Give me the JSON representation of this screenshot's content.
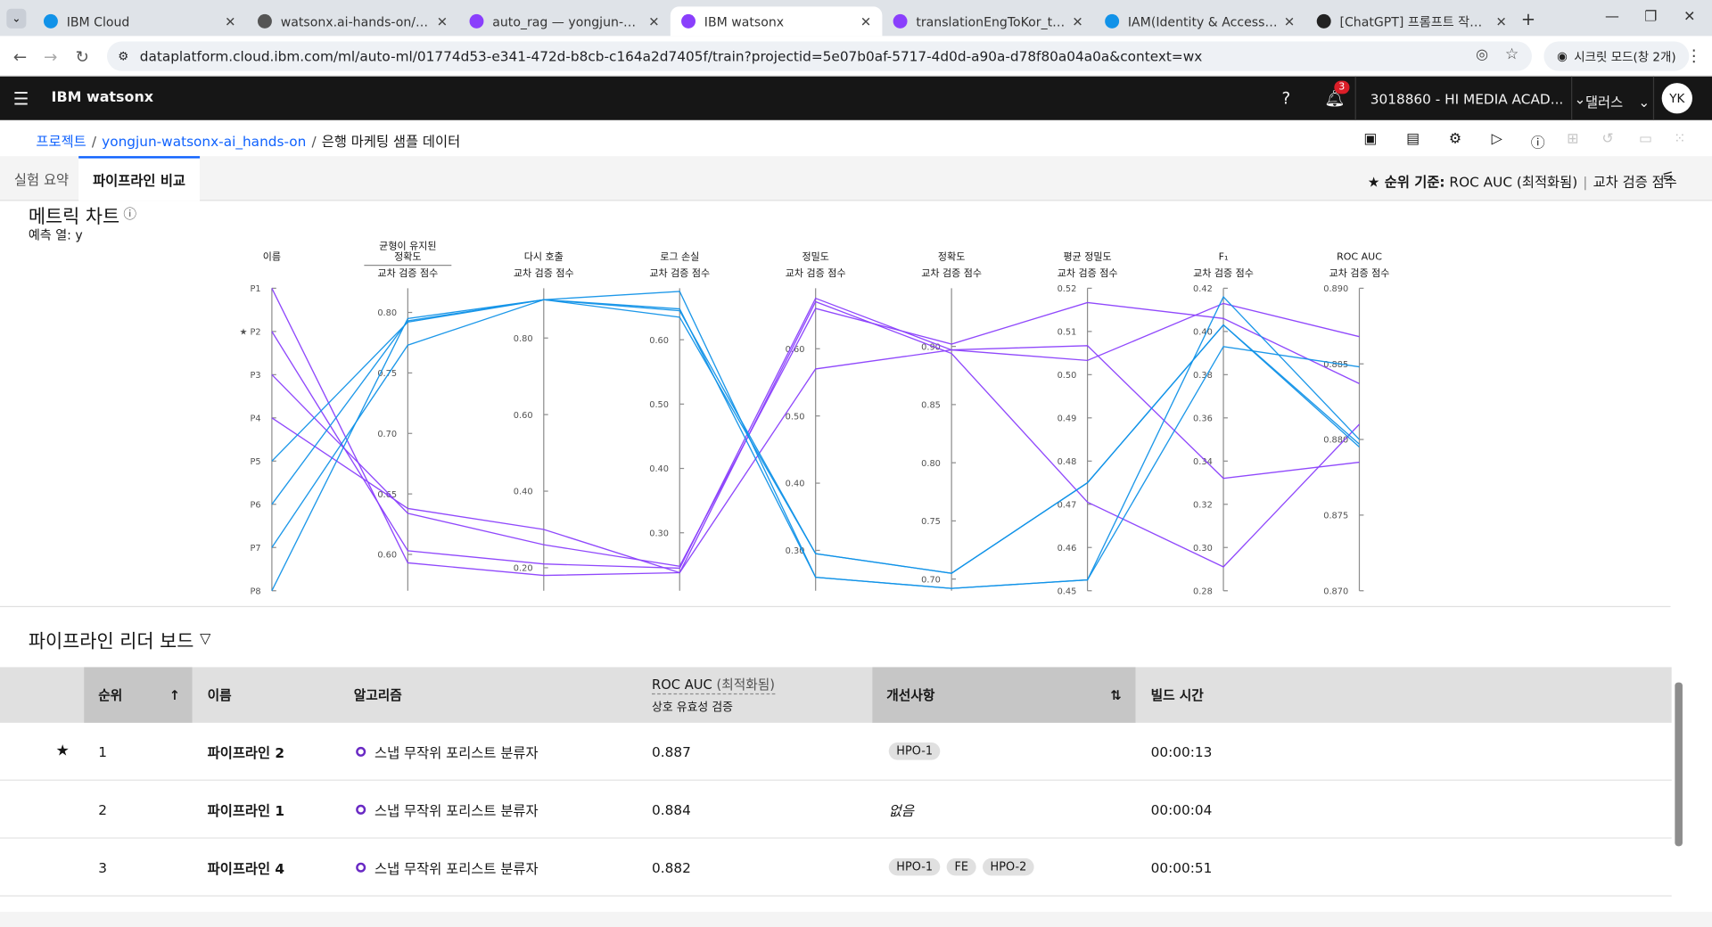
{
  "browser": {
    "tabs": [
      {
        "title": "IBM Cloud",
        "color": "#1192e8"
      },
      {
        "title": "watsonx.ai-hands-on/README",
        "color": "#555555"
      },
      {
        "title": "auto_rag — yongjun-watsonx",
        "color": "#8a3ffc"
      },
      {
        "title": "IBM watsonx",
        "color": "#8a3ffc"
      },
      {
        "title": "translationEngToKor_test — yo",
        "color": "#8a3ffc"
      },
      {
        "title": "IAM(Identity & Access Manag",
        "color": "#1192e8"
      },
      {
        "title": "[ChatGPT] 프롬프트 작성 가이",
        "color": "#222222"
      }
    ],
    "url": "dataplatform.cloud.ibm.com/ml/auto-ml/01774d53-e341-472d-b8cb-c164a2d7405f/train?projectid=5e07b0af-5717-4d0d-a90a-d78f80a04a0a&context=wx",
    "incognito_label": "시크릿 모드(창 2개)"
  },
  "app": {
    "brand": "IBM watsonx",
    "notifications": "3",
    "account": "3018860 - HI MEDIA ACAD...",
    "region": "댈러스",
    "avatar": "YK"
  },
  "breadcrumb": {
    "root": "프로젝트",
    "project": "yongjun-watsonx-ai_hands-on",
    "current": "은행 마케팅 샘플 데이터"
  },
  "subtabs": {
    "summary": "실험 요약",
    "compare": "파이프라인 비교",
    "rank_label": "★ 순위 기준:",
    "rank_metric": "ROC AUC (최적화됨)",
    "rank_score": "교차 검증 점수"
  },
  "metric": {
    "title": "메트릭 차트",
    "prediction_label": "예측 열:",
    "prediction_value": "y"
  },
  "chart_data": {
    "type": "parallel-coordinates",
    "axes": [
      {
        "label": "이름",
        "sub": "",
        "ticks": [
          "P1",
          "★ P2",
          "P3",
          "P4",
          "P5",
          "P6",
          "P7",
          "P8"
        ],
        "categorical": true
      },
      {
        "label": "균형이 유지된\n정확도",
        "sub": "교차 검증 점수",
        "min": 0.57,
        "max": 0.82,
        "ticks": [
          0.6,
          0.65,
          0.7,
          0.75,
          0.8
        ]
      },
      {
        "label": "다시 호출",
        "sub": "교차 검증 점수",
        "min": 0.14,
        "max": 0.93,
        "ticks": [
          0.2,
          0.4,
          0.6,
          0.8
        ]
      },
      {
        "label": "로그 손실",
        "sub": "교차 검증 점수",
        "min": 0.21,
        "max": 0.68,
        "ticks": [
          0.3,
          0.4,
          0.5,
          0.6
        ]
      },
      {
        "label": "정밀도",
        "sub": "교차 검증 점수",
        "min": 0.24,
        "max": 0.69,
        "ticks": [
          0.3,
          0.4,
          0.5,
          0.6
        ]
      },
      {
        "label": "정확도",
        "sub": "교차 검증 점수",
        "min": 0.69,
        "max": 0.95,
        "ticks": [
          0.7,
          0.75,
          0.8,
          0.85,
          0.9
        ]
      },
      {
        "label": "평균 정밀도",
        "sub": "교차 검증 점수",
        "min": 0.45,
        "max": 0.52,
        "ticks": [
          0.45,
          0.46,
          0.47,
          0.48,
          0.49,
          0.5,
          0.51,
          0.52
        ]
      },
      {
        "label": "F₁",
        "sub": "교차 검증 점수",
        "min": 0.28,
        "max": 0.42,
        "ticks": [
          0.28,
          0.3,
          0.32,
          0.34,
          0.36,
          0.38,
          0.4,
          0.42
        ]
      },
      {
        "label": "ROC AUC",
        "sub": "교차 검증 점수",
        "min": 0.87,
        "max": 0.89,
        "ticks": [
          0.87,
          0.875,
          0.88,
          0.885,
          0.89
        ]
      }
    ],
    "series": [
      {
        "name": "P1",
        "color": "#8a3ffc",
        "values": [
          0,
          0.593,
          0.18,
          0.238,
          0.67,
          0.894,
          0.4705,
          0.291,
          0.881
        ]
      },
      {
        "name": "P2",
        "color": "#8a3ffc",
        "values": [
          1,
          0.603,
          0.21,
          0.245,
          0.675,
          0.897,
          0.5033,
          0.413,
          0.8868
        ]
      },
      {
        "name": "P3",
        "color": "#8a3ffc",
        "values": [
          2,
          0.634,
          0.26,
          0.248,
          0.66,
          0.902,
          0.5167,
          0.406,
          0.8837
        ]
      },
      {
        "name": "P4",
        "color": "#8a3ffc",
        "values": [
          3,
          0.638,
          0.3,
          0.238,
          0.57,
          0.897,
          0.5067,
          0.332,
          0.8785
        ]
      },
      {
        "name": "P5",
        "color": "#1192e8",
        "values": [
          4,
          0.792,
          0.9,
          0.635,
          0.295,
          0.705,
          0.475,
          0.403,
          0.8795
        ]
      },
      {
        "name": "P6",
        "color": "#1192e8",
        "values": [
          5,
          0.793,
          0.9,
          0.645,
          0.295,
          0.705,
          0.475,
          0.403,
          0.8797
        ]
      },
      {
        "name": "P7",
        "color": "#1192e8",
        "values": [
          6,
          0.773,
          0.9,
          0.648,
          0.26,
          0.692,
          0.4525,
          0.393,
          0.8848
        ]
      },
      {
        "name": "P8",
        "color": "#1192e8",
        "values": [
          7,
          0.795,
          0.9,
          0.675,
          0.26,
          0.692,
          0.4525,
          0.416,
          0.88
        ]
      }
    ]
  },
  "leaderboard": {
    "title": "파이프라인 리더 보드",
    "columns": {
      "rank": "순위",
      "name": "이름",
      "algorithm": "알고리즘",
      "roc": "ROC AUC",
      "roc_note": "(최적화됨)",
      "roc_sub": "상호 유효성 검증",
      "enhancements": "개선사항",
      "build": "빌드 시간"
    },
    "rows": [
      {
        "rank": "1",
        "star": "★",
        "name": "파이프라인 2",
        "algorithm": "스냅 무작위 포리스트 분류자",
        "roc": "0.887",
        "enh": [
          "HPO-1"
        ],
        "none": "",
        "build": "00:00:13"
      },
      {
        "rank": "2",
        "star": "",
        "name": "파이프라인 1",
        "algorithm": "스냅 무작위 포리스트 분류자",
        "roc": "0.884",
        "enh": [],
        "none": "없음",
        "build": "00:00:04"
      },
      {
        "rank": "3",
        "star": "",
        "name": "파이프라인 4",
        "algorithm": "스냅 무작위 포리스트 분류자",
        "roc": "0.882",
        "enh": [
          "HPO-1",
          "FE",
          "HPO-2"
        ],
        "none": "",
        "build": "00:00:51"
      }
    ]
  }
}
